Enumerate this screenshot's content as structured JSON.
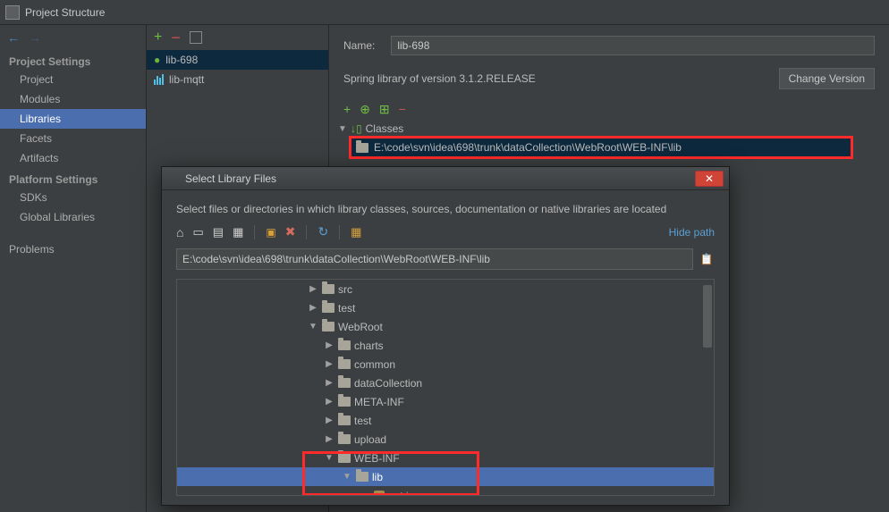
{
  "window": {
    "title": "Project Structure"
  },
  "sidebar": {
    "groups": [
      {
        "label": "Project Settings",
        "items": [
          "Project",
          "Modules",
          "Libraries",
          "Facets",
          "Artifacts"
        ],
        "selectedIndex": 2
      },
      {
        "label": "Platform Settings",
        "items": [
          "SDKs",
          "Global Libraries"
        ]
      },
      {
        "label": "",
        "items": [
          "Problems"
        ]
      }
    ]
  },
  "libraries": {
    "items": [
      {
        "name": "lib-698",
        "kind": "spring",
        "selected": true
      },
      {
        "name": "lib-mqtt",
        "kind": "bars",
        "selected": false
      }
    ]
  },
  "details": {
    "nameLabel": "Name:",
    "nameValue": "lib-698",
    "description": "Spring library of version 3.1.2.RELEASE",
    "changeVersionLabel": "Change Version",
    "classesLabel": "Classes",
    "classesPath": "E:\\code\\svn\\idea\\698\\trunk\\dataCollection\\WebRoot\\WEB-INF\\lib"
  },
  "dialog": {
    "title": "Select Library Files",
    "hint": "Select files or directories in which library classes, sources, documentation or native libraries are located",
    "hidePath": "Hide path",
    "pathValue": "E:\\code\\svn\\idea\\698\\trunk\\dataCollection\\WebRoot\\WEB-INF\\lib",
    "tree": [
      {
        "indent": 1,
        "expanded": false,
        "type": "folder",
        "name": "src"
      },
      {
        "indent": 1,
        "expanded": false,
        "type": "folder",
        "name": "test"
      },
      {
        "indent": 1,
        "expanded": true,
        "type": "folder",
        "name": "WebRoot"
      },
      {
        "indent": 2,
        "expanded": false,
        "type": "folder",
        "name": "charts"
      },
      {
        "indent": 2,
        "expanded": false,
        "type": "folder",
        "name": "common"
      },
      {
        "indent": 2,
        "expanded": false,
        "type": "folder",
        "name": "dataCollection"
      },
      {
        "indent": 2,
        "expanded": false,
        "type": "folder",
        "name": "META-INF"
      },
      {
        "indent": 2,
        "expanded": false,
        "type": "folder",
        "name": "test"
      },
      {
        "indent": 2,
        "expanded": false,
        "type": "folder",
        "name": "upload"
      },
      {
        "indent": 2,
        "expanded": true,
        "type": "folder",
        "name": "WEB-INF"
      },
      {
        "indent": 3,
        "expanded": true,
        "type": "folder",
        "name": "lib",
        "selected": true
      },
      {
        "indent": 4,
        "expanded": null,
        "type": "jar",
        "name": "ant.jar"
      }
    ]
  }
}
